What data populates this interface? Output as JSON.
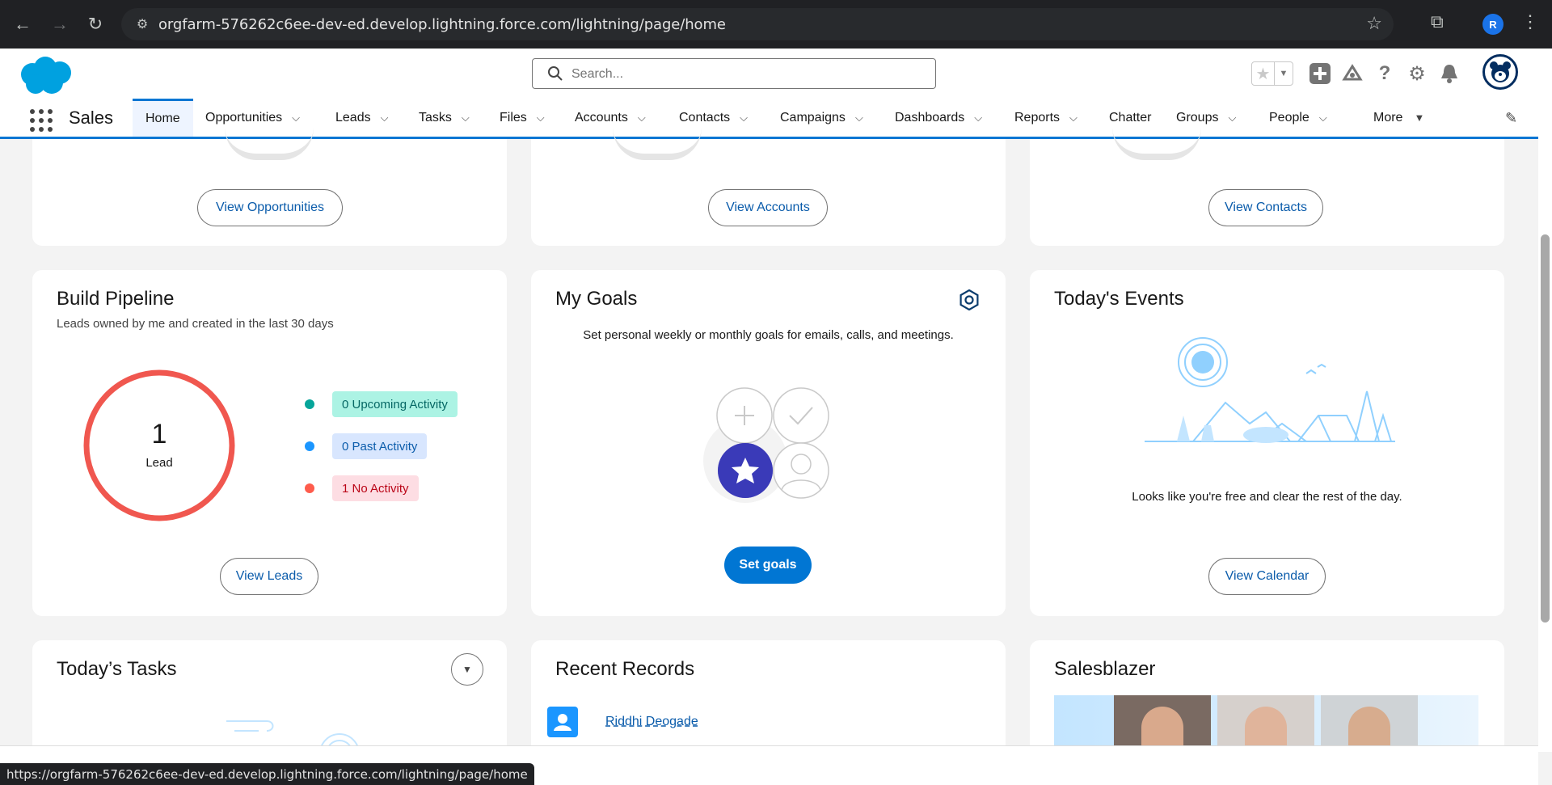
{
  "browser": {
    "url": "orgfarm-576262c6ee-dev-ed.develop.lightning.force.com/lightning/page/home",
    "profile_initial": "R",
    "status_url": "https://orgfarm-576262c6ee-dev-ed.develop.lightning.force.com/lightning/page/home"
  },
  "header": {
    "search_placeholder": "Search..."
  },
  "nav": {
    "app_name": "Sales",
    "items": [
      {
        "label": "Home"
      },
      {
        "label": "Opportunities"
      },
      {
        "label": "Leads"
      },
      {
        "label": "Tasks"
      },
      {
        "label": "Files"
      },
      {
        "label": "Accounts"
      },
      {
        "label": "Contacts"
      },
      {
        "label": "Campaigns"
      },
      {
        "label": "Dashboards"
      },
      {
        "label": "Reports"
      },
      {
        "label": "Chatter"
      },
      {
        "label": "Groups"
      },
      {
        "label": "People"
      },
      {
        "label": "More"
      }
    ]
  },
  "top_cards": {
    "opportunities_button": "View Opportunities",
    "accounts_button": "View Accounts",
    "contacts_button": "View Contacts"
  },
  "pipeline": {
    "title": "Build Pipeline",
    "subtitle": "Leads owned by me and created in the last 30 days",
    "count": "1",
    "count_label": "Lead",
    "legend": [
      {
        "label": "0 Upcoming Activity",
        "dot": "#06a59a",
        "bg": "#acf3e4",
        "fg": "#056764"
      },
      {
        "label": "0 Past Activity",
        "dot": "#1b96ff",
        "bg": "#d8e6fe",
        "fg": "#0b5cab"
      },
      {
        "label": "1 No Activity",
        "dot": "#fe5c4c",
        "bg": "#fddde3",
        "fg": "#ba0517"
      }
    ],
    "button": "View Leads",
    "ring_color": "#f0574f"
  },
  "goals": {
    "title": "My Goals",
    "description": "Set personal weekly or monthly goals for emails, calls, and meetings.",
    "button": "Set goals"
  },
  "events": {
    "title": "Today's Events",
    "message": "Looks like you're free and clear the rest of the day.",
    "button": "View Calendar"
  },
  "tasks": {
    "title": "Today’s Tasks"
  },
  "recent": {
    "title": "Recent Records",
    "records": [
      {
        "name": "Riddhi Deogade"
      }
    ]
  },
  "salesblazer": {
    "title": "Salesblazer"
  }
}
